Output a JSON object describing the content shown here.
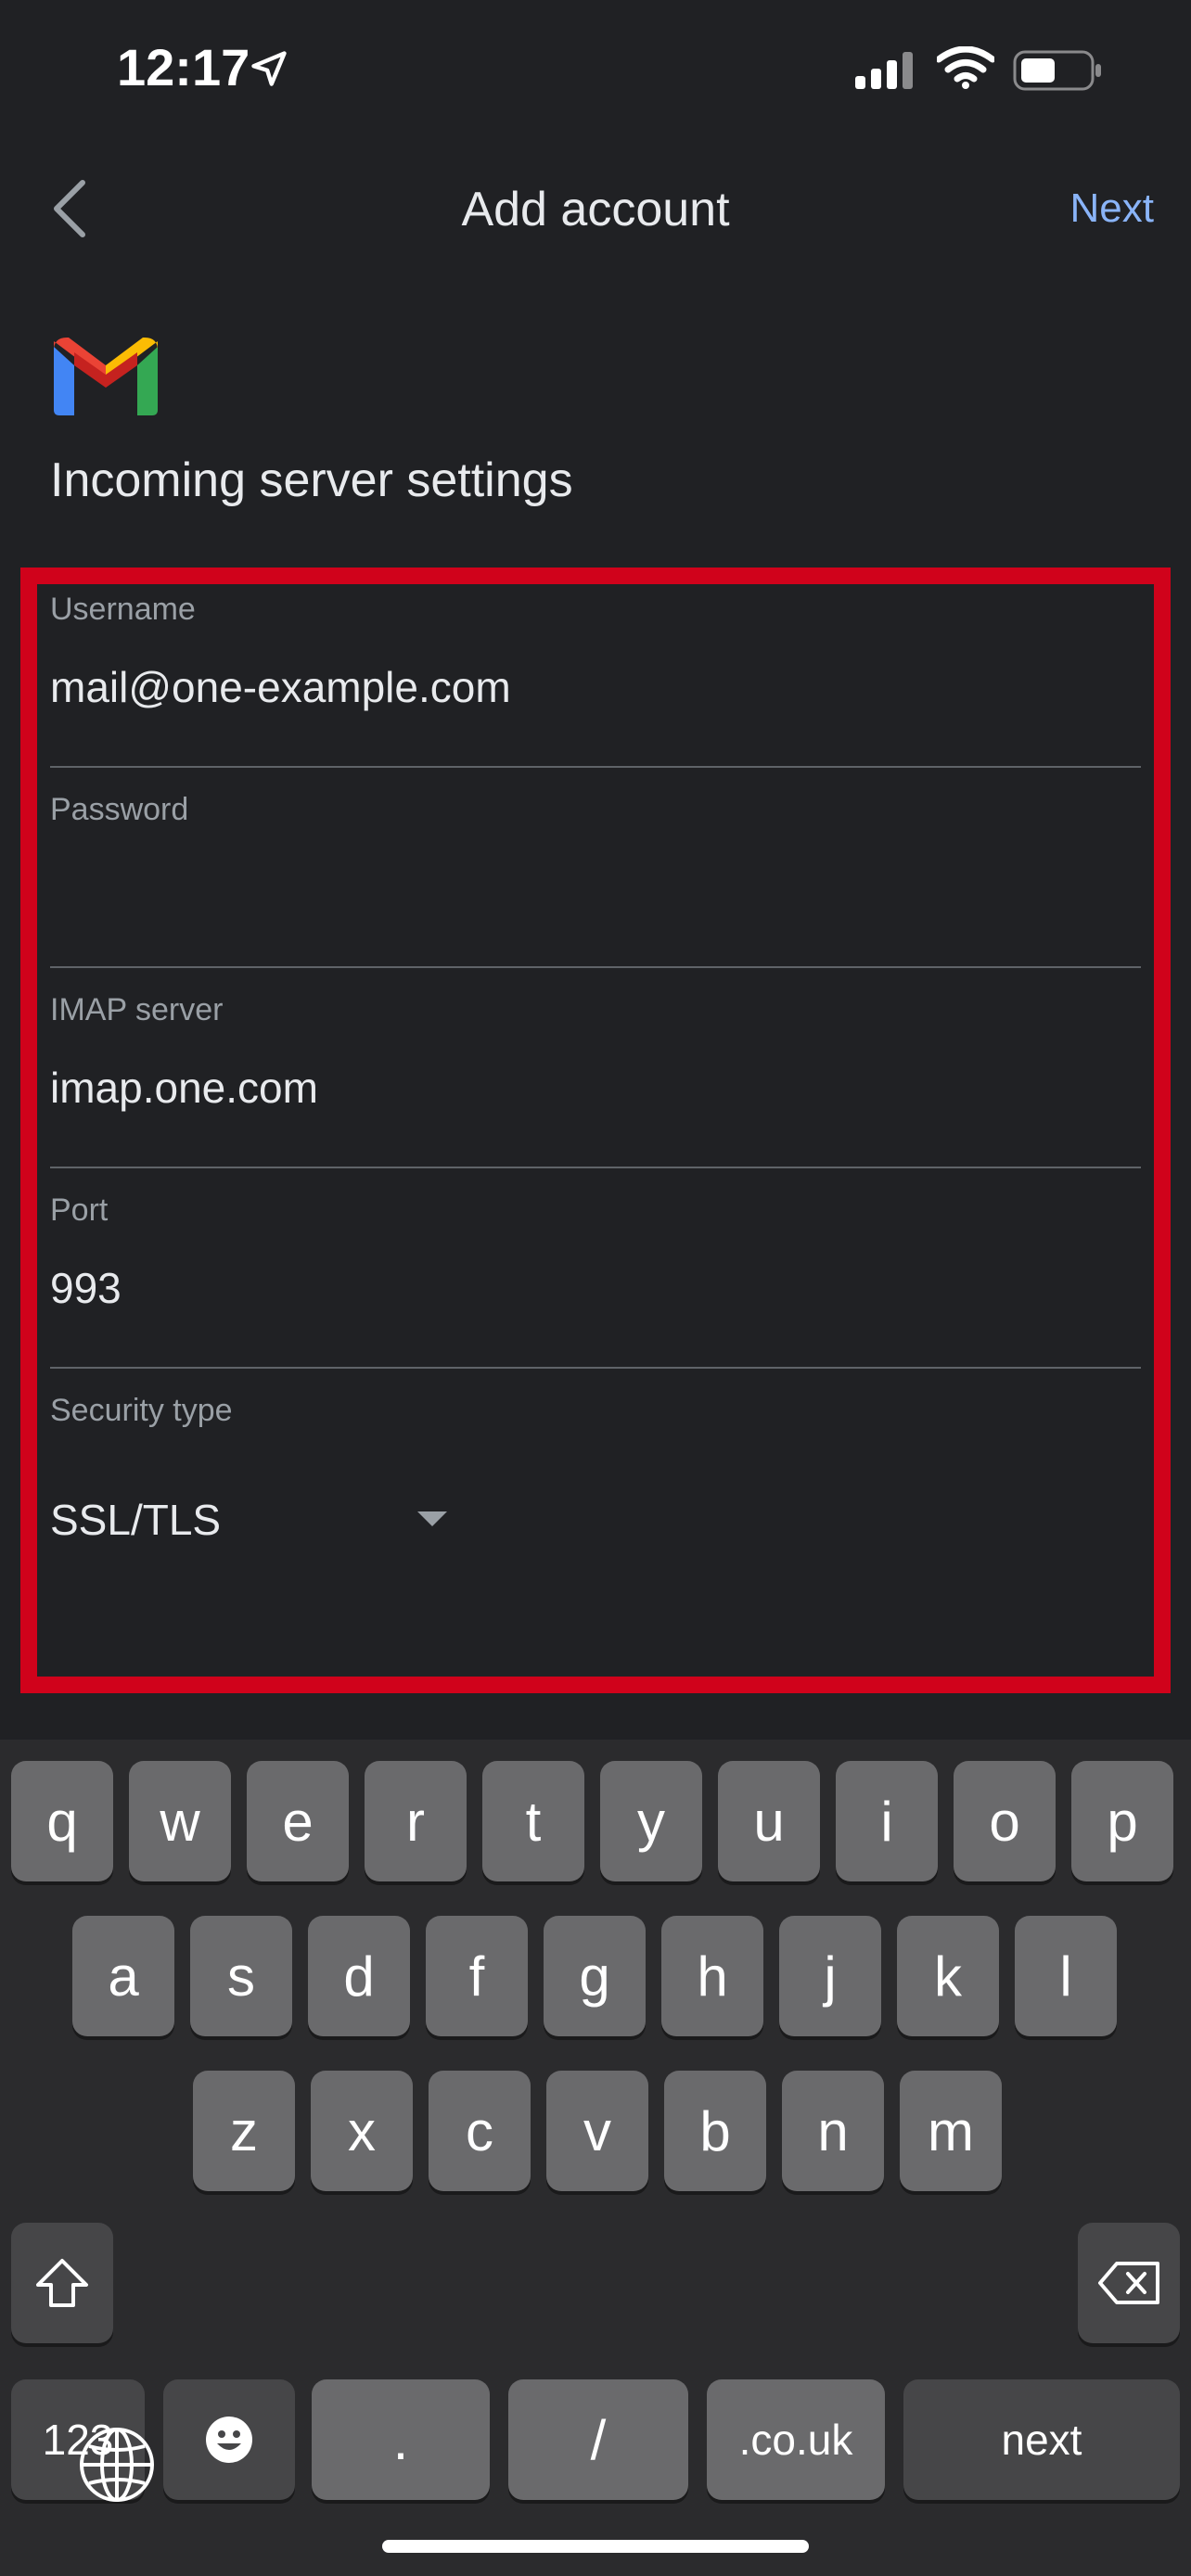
{
  "status": {
    "time": "12:17"
  },
  "topbar": {
    "title": "Add account",
    "next_label": "Next"
  },
  "section": {
    "title": "Incoming server settings"
  },
  "fields": {
    "username": {
      "label": "Username",
      "value": "mail@one-example.com"
    },
    "password": {
      "label": "Password",
      "value": ""
    },
    "imap": {
      "label": "IMAP server",
      "value": "imap.one.com"
    },
    "port": {
      "label": "Port",
      "value": "993"
    },
    "security": {
      "label": "Security type",
      "value": "SSL/TLS"
    }
  },
  "keyboard": {
    "row1": [
      "q",
      "w",
      "e",
      "r",
      "t",
      "y",
      "u",
      "i",
      "o",
      "p"
    ],
    "row2": [
      "a",
      "s",
      "d",
      "f",
      "g",
      "h",
      "j",
      "k",
      "l"
    ],
    "row3": [
      "z",
      "x",
      "c",
      "v",
      "b",
      "n",
      "m"
    ],
    "numbers_label": "123",
    "dot_label": ".",
    "slash_label": "/",
    "couk_label": ".co.uk",
    "next_label": "next"
  },
  "colors": {
    "accent": "#8ab4f8",
    "highlight": "#d0021b",
    "background": "#202124"
  }
}
